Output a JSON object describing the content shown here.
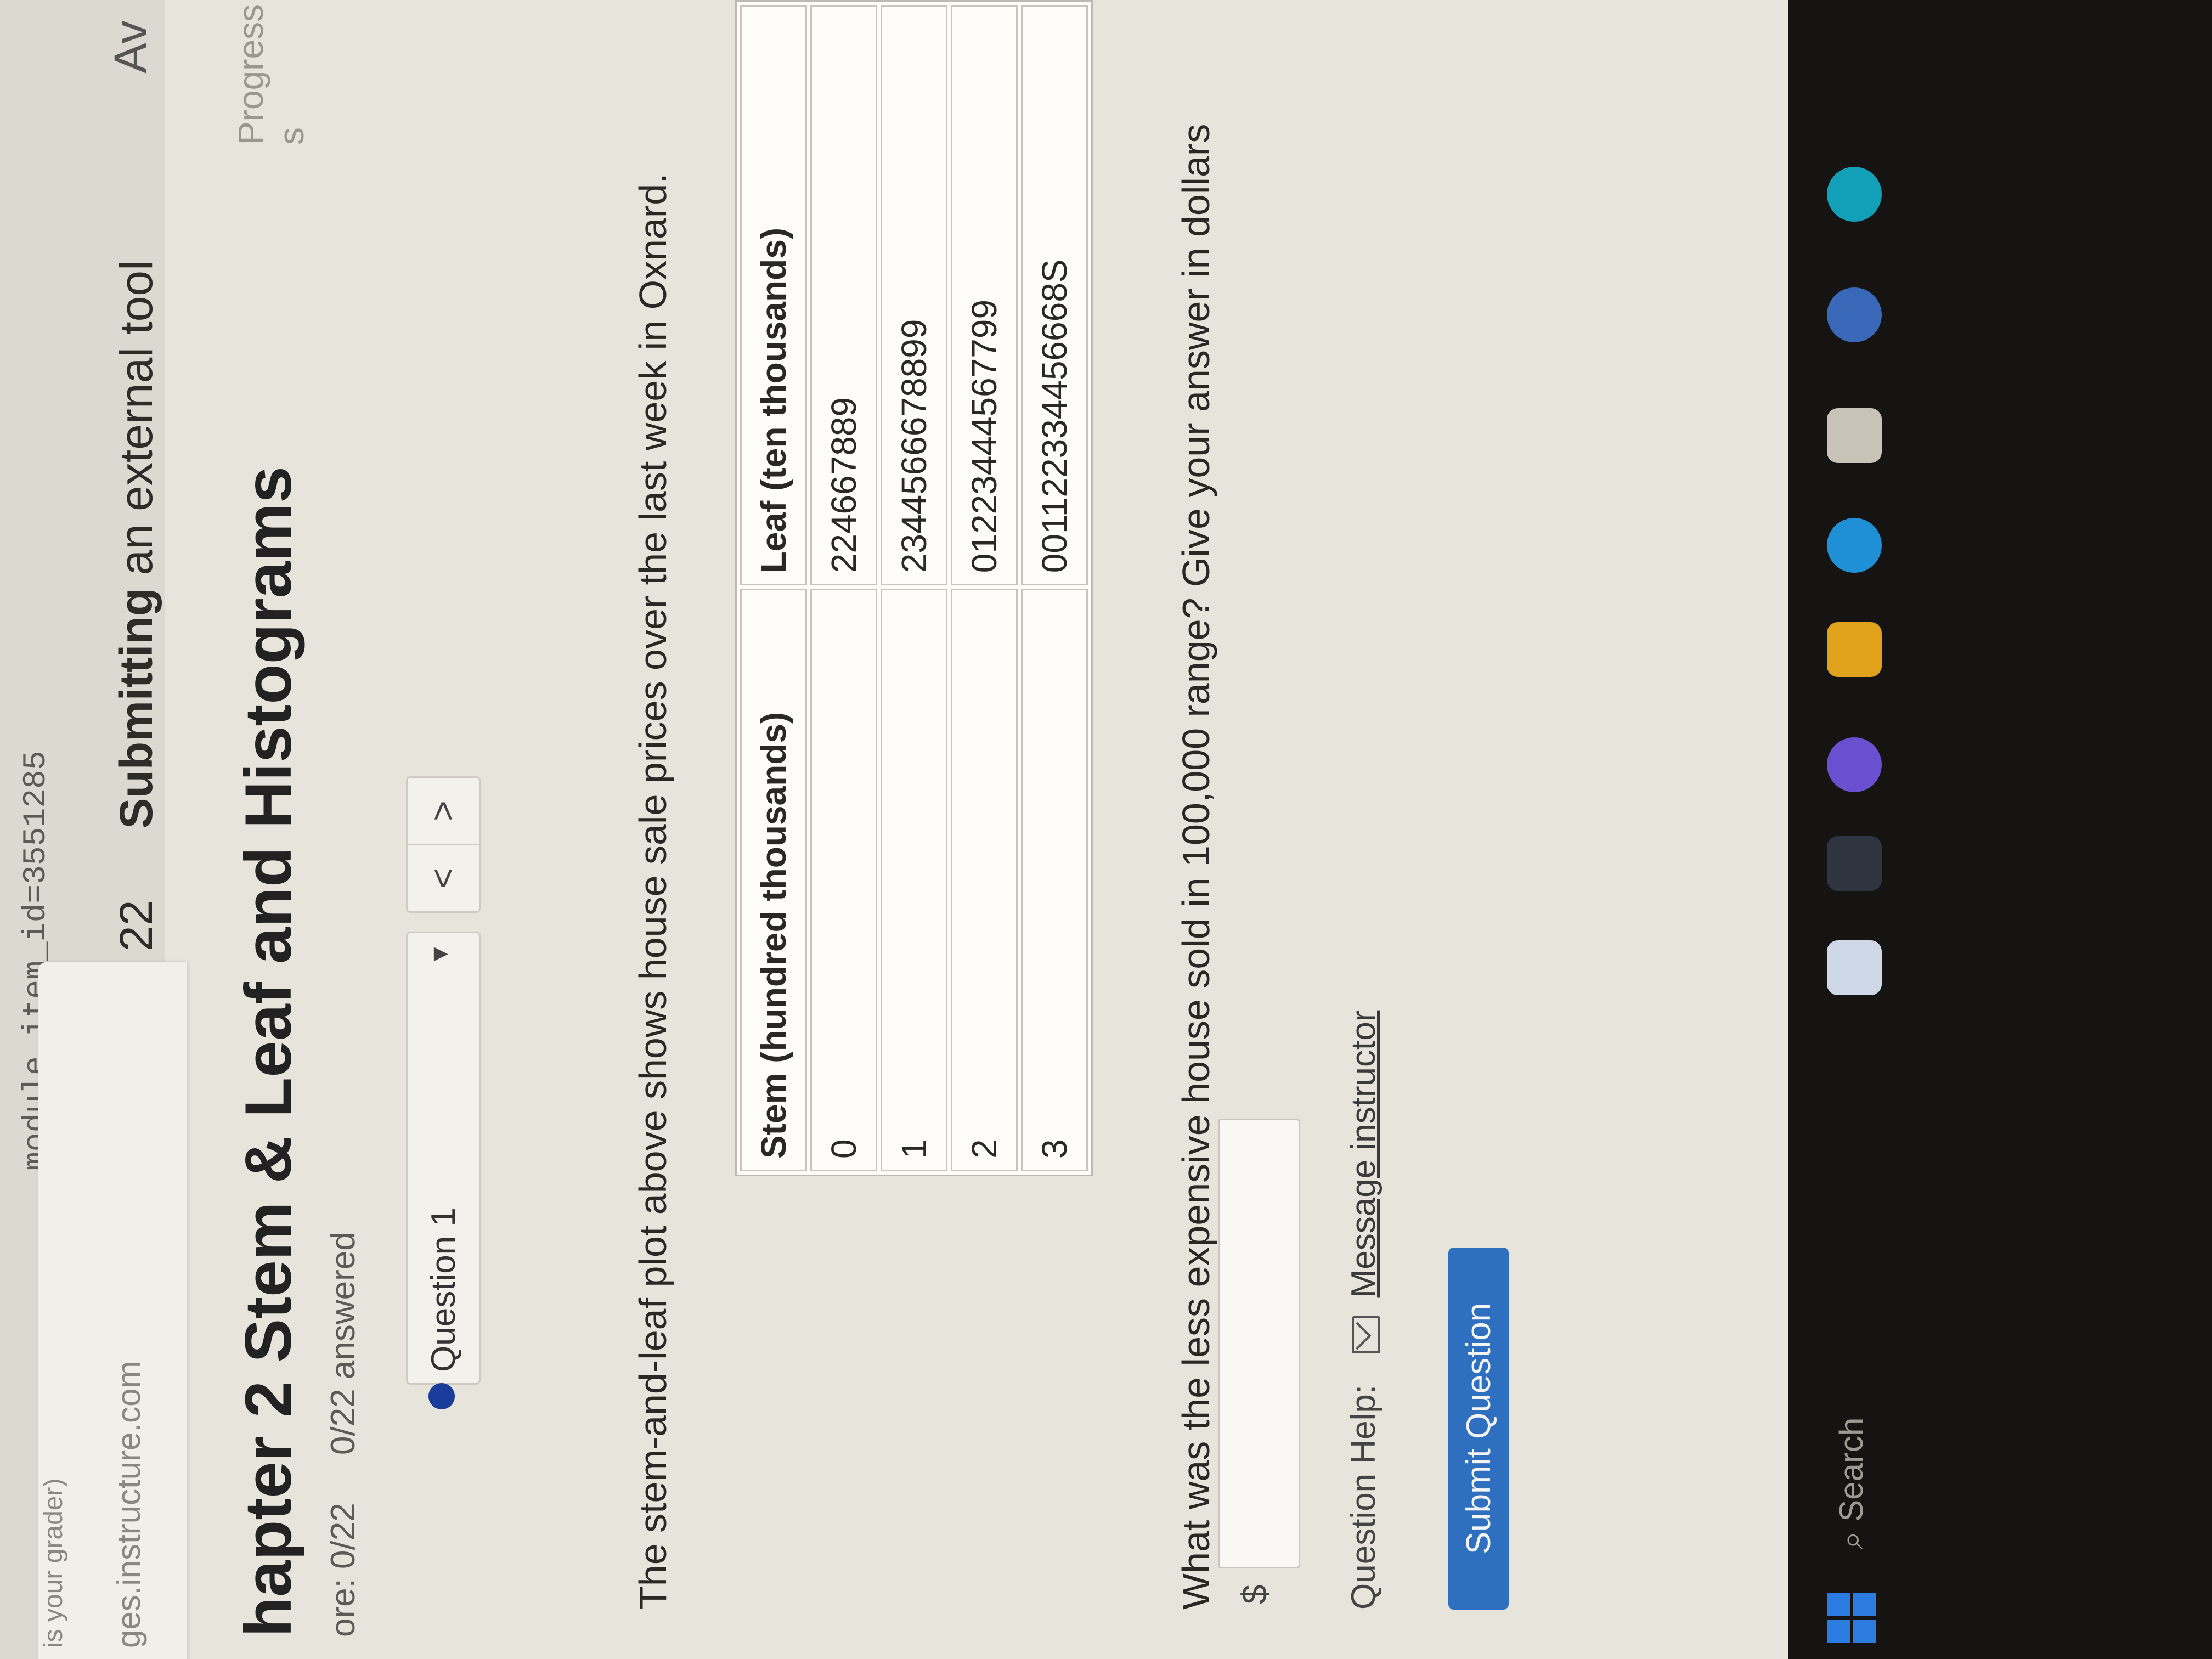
{
  "browser": {
    "url_fragment": "module_item_id=3551285",
    "tab_line1": "is your grader)",
    "tab_line2": "ges.instructure.com",
    "ext_tool_number": "22",
    "ext_tool_bold": "Submitting",
    "ext_tool_rest": "an external tool",
    "ext_tool_trailing": "Av"
  },
  "assignment": {
    "title": "hapter 2 Stem & Leaf and Histograms",
    "score": "ore: 0/22",
    "answered": "0/22 answered",
    "progress_label": "Progress s"
  },
  "question_nav": {
    "selected": "Question 1",
    "prev_glyph": "<",
    "next_glyph": ">"
  },
  "question": {
    "prompt": "The stem-and-leaf plot above shows house sale prices over the last week in Oxnard.",
    "table": {
      "headers": [
        "Stem (hundred thousands)",
        "Leaf (ten thousands)"
      ],
      "rows": [
        [
          "0",
          "224667889"
        ],
        [
          "1",
          "2344566678899"
        ],
        [
          "2",
          "01223444567799"
        ],
        [
          "3",
          "001122334456668S"
        ]
      ]
    },
    "ask": "What was the less expensive house sold in 100,000 range? Give your answer in dollars",
    "currency": "$",
    "answer_value": "",
    "help_label": "Question Help:",
    "message_label": "Message instructor",
    "submit_label": "Submit Question"
  },
  "taskbar": {
    "search_label": "Search"
  }
}
